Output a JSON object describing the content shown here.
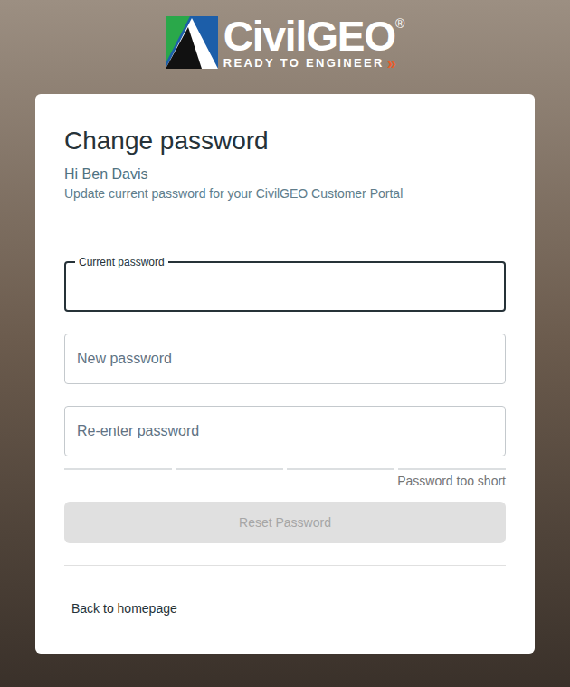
{
  "logo": {
    "name": "CivilGEO",
    "registered": "®",
    "tagline": "READY TO ENGINEER",
    "arrows": "»"
  },
  "card": {
    "title": "Change password",
    "greeting": "Hi Ben Davis",
    "subtitle": "Update current password for your CivilGEO Customer Portal"
  },
  "fields": [
    {
      "label": "Current password",
      "focused": true,
      "value": ""
    },
    {
      "label": "New password",
      "focused": false,
      "value": ""
    },
    {
      "label": "Re-enter password",
      "focused": false,
      "value": ""
    }
  ],
  "strength": {
    "segments": [
      {
        "filled": false
      },
      {
        "filled": false
      },
      {
        "filled": false
      },
      {
        "filled": false
      }
    ],
    "text": "Password too short"
  },
  "submit": {
    "label": "Reset Password",
    "disabled": true
  },
  "link": {
    "label": "Back to homepage"
  }
}
